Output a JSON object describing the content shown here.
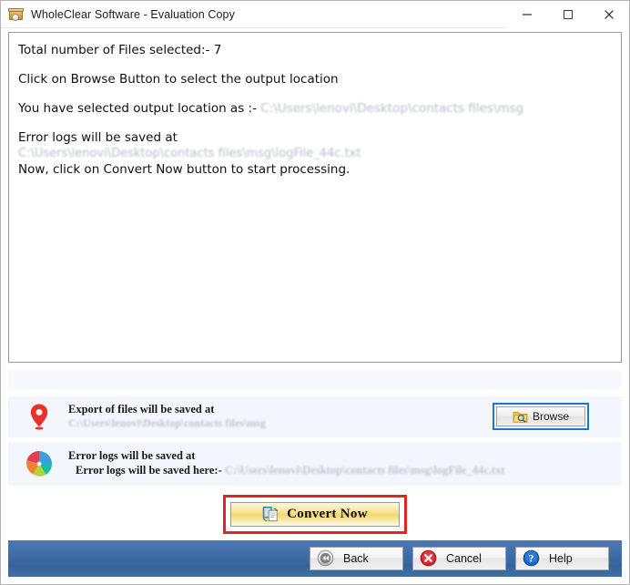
{
  "window": {
    "title": "WholeClear Software - Evaluation Copy",
    "icon": "archive-box-icon",
    "controls": {
      "minimize": "minimize-icon",
      "maximize": "maximize-icon",
      "close": "close-icon"
    }
  },
  "log": {
    "line1": "Total number of Files selected:-  7",
    "line2": "Click on Browse Button to select the output location",
    "line3_prefix": "You have selected output location as :- ",
    "line3_path": "C:\\Users\\lenovi\\Desktop\\contacts files\\msg",
    "line4": "Error logs will be saved at",
    "line5_path": "C:\\Users\\lenovi\\Desktop\\contacts files\\msg\\logFile_44c.txt",
    "line6": "Now, click on Convert Now button to start processing."
  },
  "export_row": {
    "icon": "location-pin-icon",
    "title": "Export of files will be saved at",
    "path": "C:\\Users\\lenovi\\Desktop\\contacts files\\msg",
    "browse_label": "Browse",
    "browse_icon": "folder-search-icon"
  },
  "errorlog_row": {
    "icon": "pie-chart-icon",
    "title": "Error logs will be saved at",
    "subtitle_prefix": "Error logs will be saved here:- ",
    "subtitle_path": "C:\\Users\\lenovi\\Desktop\\contacts files\\msg\\logFile_44c.txt"
  },
  "convert": {
    "label": "Convert Now",
    "icon": "copy-convert-icon",
    "highlight_color": "#e52421",
    "button_color": "#f2d96a"
  },
  "footer": {
    "back_label": "Back",
    "back_icon": "rewind-icon",
    "cancel_label": "Cancel",
    "cancel_icon": "cancel-x-icon",
    "help_label": "Help",
    "help_icon": "question-mark-icon",
    "bar_color": "#3f6ca6"
  }
}
